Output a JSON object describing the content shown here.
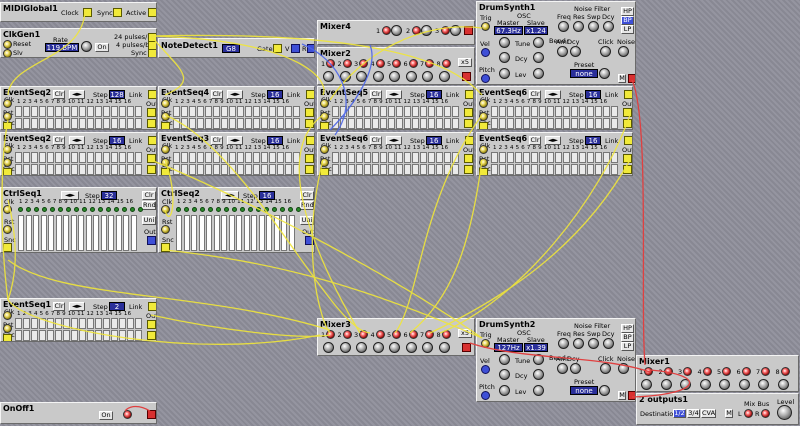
{
  "midi_global": {
    "title": "MIDIGlobal1",
    "clock": "Clock",
    "sync": "Sync",
    "active": "Active"
  },
  "clkgen": {
    "title": "ClkGen1",
    "reset": "Reset",
    "slv": "Slv",
    "rate_label": "Rate",
    "rate_value": "119 BPM",
    "on": "On",
    "pulses1": "24 pulses/b",
    "pulses2": "4 pulses/b",
    "sync": "Sync"
  },
  "notedetect": {
    "title": "NoteDetect1",
    "note": "G8",
    "gate": "Gate",
    "v": "V",
    "r": "R"
  },
  "mixer4": {
    "title": "Mixer4",
    "ch": [
      "1",
      "2",
      "3"
    ]
  },
  "mixer2": {
    "title": "Mixer2",
    "ch": [
      "1",
      "2",
      "3",
      "4",
      "5",
      "6",
      "7",
      "8"
    ],
    "x5": "x5"
  },
  "mixer3": {
    "title": "Mixer3",
    "ch": [
      "1",
      "2",
      "3",
      "4",
      "5",
      "6",
      "7",
      "8"
    ],
    "x5": "x5"
  },
  "mixer1": {
    "title": "Mixer1",
    "ch": [
      "1",
      "2",
      "3",
      "4",
      "5",
      "6",
      "7",
      "8"
    ]
  },
  "drum1": {
    "title": "DrumSynth1",
    "trig": "Trig",
    "vel": "Vel",
    "pitch": "Pitch",
    "osc": "OSC",
    "master": "Master",
    "slave": "Slave",
    "master_val": "67.3Hz",
    "slave_val": "x1.24",
    "tune": "Tune",
    "dcy": "Dcy",
    "lev": "Lev",
    "bend": "Bend",
    "amt": "Amt",
    "noise_filter": "Noise Filter",
    "freq": "Freq",
    "res": "Res",
    "swp": "Swp",
    "click": "Click",
    "noise": "Noise",
    "preset": "Preset",
    "preset_val": "none",
    "hp": "HP",
    "bp": "BP",
    "lp": "LP",
    "m": "M"
  },
  "drum2": {
    "title": "DrumSynth2",
    "trig": "Trig",
    "vel": "Vel",
    "pitch": "Pitch",
    "osc": "OSC",
    "master": "Master",
    "slave": "Slave",
    "master_val": "127Hz",
    "slave_val": "x1.39",
    "tune": "Tune",
    "dcy": "Dcy",
    "lev": "Lev",
    "bend": "Bend",
    "amt": "Amt",
    "noise_filter": "Noise Filter",
    "freq": "Freq",
    "res": "Res",
    "swp": "Swp",
    "click": "Click",
    "noise": "Noise",
    "preset": "Preset",
    "preset_val": "none",
    "hp": "HP",
    "bp": "BP",
    "lp": "LP",
    "m": "M"
  },
  "seq": {
    "clr": "Clr",
    "rnd": "Rnd",
    "step": "Step",
    "link": "Link",
    "clk": "Clk",
    "rst": "Rst",
    "snc": "Snc",
    "out": "Out",
    "uni": "Uni",
    "nums": "1 2 3 4 5 6 7 8 9 10 11 12 13 14 15 16"
  },
  "eventseqs": [
    {
      "title": "EventSeq2",
      "step": "128"
    },
    {
      "title": "EventSeq4",
      "step": "16"
    },
    {
      "title": "EventSeq5",
      "step": "16"
    },
    {
      "title": "EventSeq6",
      "step": "16"
    },
    {
      "title": "EventSeq2",
      "step": "16"
    },
    {
      "title": "EventSeq3",
      "step": "16"
    },
    {
      "title": "EventSeq6",
      "step": "16"
    },
    {
      "title": "EventSeq6",
      "step": "16"
    },
    {
      "title": "EventSeq1",
      "step": "2"
    }
  ],
  "ctrlseq1": {
    "title": "CtrlSeq1",
    "step": "32"
  },
  "ctrlseq2": {
    "title": "CtrlSeq2",
    "step": "16"
  },
  "onoff": {
    "title": "OnOff1",
    "on": "On"
  },
  "outputs": {
    "title": "2 outputs1",
    "destination": "Destination",
    "d1": "1/2",
    "d2": "3/4",
    "d3": "CVA",
    "m": "M",
    "l": "L",
    "r": "R",
    "mixbus": "Mix Bus",
    "level": "Level"
  }
}
